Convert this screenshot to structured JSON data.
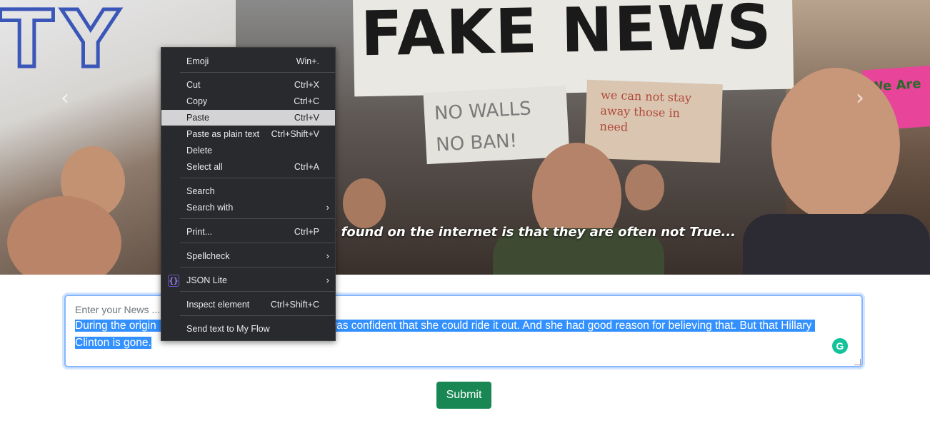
{
  "hero": {
    "sign_big_text": "FAKE NEWS",
    "sign_left_text": "TY",
    "sign_small1_text": "NO WALLS NO BAN!",
    "sign_small2_text": "we can not stay away those in need",
    "sign_pink_text": "We Are",
    "caption": "uotes found on the internet is that they are often not True...",
    "prev_icon": "chevron-left-icon",
    "next_icon": "chevron-right-icon"
  },
  "form": {
    "placeholder": "Enter your News ...",
    "value_line1": "During the origin                                                        was confident that she could ride it out. And she had good reason for believing that. But that Hillary ",
    "value_line2": "Clinton is gone.",
    "grammarly_glyph": "G",
    "submit_label": "Submit"
  },
  "context_menu": {
    "items": [
      {
        "label": "Emoji",
        "shortcut": "Win+."
      },
      {
        "label": "Cut",
        "shortcut": "Ctrl+X"
      },
      {
        "label": "Copy",
        "shortcut": "Ctrl+C"
      },
      {
        "label": "Paste",
        "shortcut": "Ctrl+V"
      },
      {
        "label": "Paste as plain text",
        "shortcut": "Ctrl+Shift+V"
      },
      {
        "label": "Delete",
        "shortcut": ""
      },
      {
        "label": "Select all",
        "shortcut": "Ctrl+A"
      },
      {
        "label": "Search",
        "shortcut": ""
      },
      {
        "label": "Search with",
        "shortcut": ""
      },
      {
        "label": "Print...",
        "shortcut": "Ctrl+P"
      },
      {
        "label": "Spellcheck",
        "shortcut": ""
      },
      {
        "label": "JSON Lite",
        "shortcut": ""
      },
      {
        "label": "Inspect element",
        "shortcut": "Ctrl+Shift+C"
      },
      {
        "label": "Send text to My Flow",
        "shortcut": ""
      }
    ],
    "json_icon_glyph": "{}",
    "submenu_arrow": "›"
  },
  "colors": {
    "menu_bg": "#292a2d",
    "highlight": "#d3d3d6",
    "selection": "#3390ff",
    "submit": "#198754",
    "focus_border": "#86b7fe"
  }
}
